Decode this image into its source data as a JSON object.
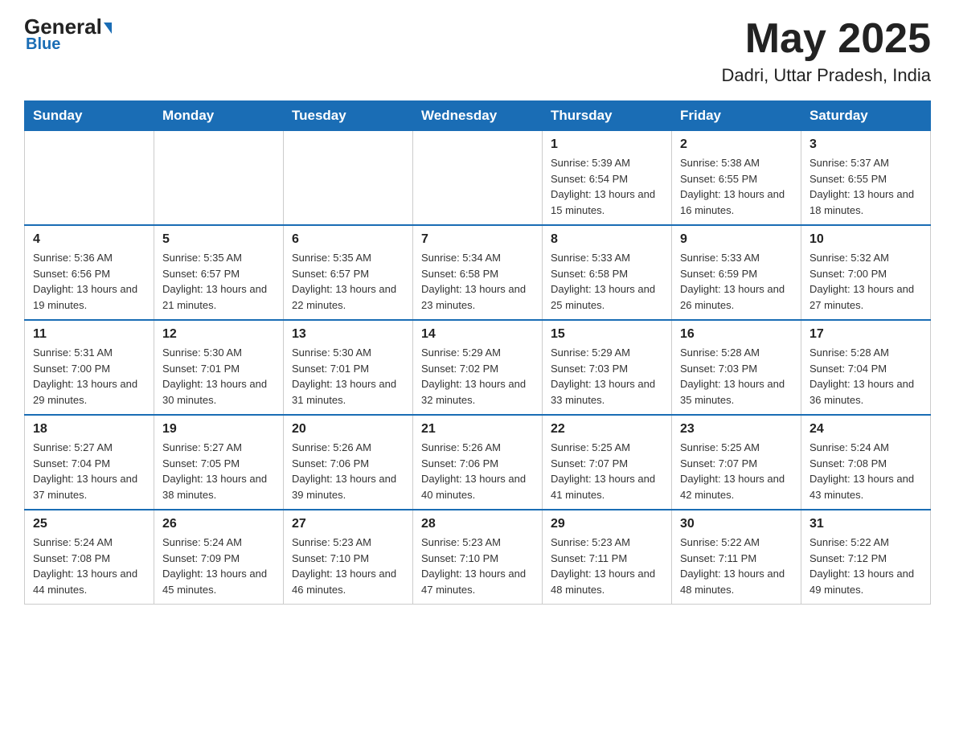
{
  "header": {
    "logo_general": "General",
    "logo_blue": "Blue",
    "month_year": "May 2025",
    "location": "Dadri, Uttar Pradesh, India"
  },
  "weekdays": [
    "Sunday",
    "Monday",
    "Tuesday",
    "Wednesday",
    "Thursday",
    "Friday",
    "Saturday"
  ],
  "weeks": [
    [
      {
        "day": "",
        "info": ""
      },
      {
        "day": "",
        "info": ""
      },
      {
        "day": "",
        "info": ""
      },
      {
        "day": "",
        "info": ""
      },
      {
        "day": "1",
        "info": "Sunrise: 5:39 AM\nSunset: 6:54 PM\nDaylight: 13 hours and 15 minutes."
      },
      {
        "day": "2",
        "info": "Sunrise: 5:38 AM\nSunset: 6:55 PM\nDaylight: 13 hours and 16 minutes."
      },
      {
        "day": "3",
        "info": "Sunrise: 5:37 AM\nSunset: 6:55 PM\nDaylight: 13 hours and 18 minutes."
      }
    ],
    [
      {
        "day": "4",
        "info": "Sunrise: 5:36 AM\nSunset: 6:56 PM\nDaylight: 13 hours and 19 minutes."
      },
      {
        "day": "5",
        "info": "Sunrise: 5:35 AM\nSunset: 6:57 PM\nDaylight: 13 hours and 21 minutes."
      },
      {
        "day": "6",
        "info": "Sunrise: 5:35 AM\nSunset: 6:57 PM\nDaylight: 13 hours and 22 minutes."
      },
      {
        "day": "7",
        "info": "Sunrise: 5:34 AM\nSunset: 6:58 PM\nDaylight: 13 hours and 23 minutes."
      },
      {
        "day": "8",
        "info": "Sunrise: 5:33 AM\nSunset: 6:58 PM\nDaylight: 13 hours and 25 minutes."
      },
      {
        "day": "9",
        "info": "Sunrise: 5:33 AM\nSunset: 6:59 PM\nDaylight: 13 hours and 26 minutes."
      },
      {
        "day": "10",
        "info": "Sunrise: 5:32 AM\nSunset: 7:00 PM\nDaylight: 13 hours and 27 minutes."
      }
    ],
    [
      {
        "day": "11",
        "info": "Sunrise: 5:31 AM\nSunset: 7:00 PM\nDaylight: 13 hours and 29 minutes."
      },
      {
        "day": "12",
        "info": "Sunrise: 5:30 AM\nSunset: 7:01 PM\nDaylight: 13 hours and 30 minutes."
      },
      {
        "day": "13",
        "info": "Sunrise: 5:30 AM\nSunset: 7:01 PM\nDaylight: 13 hours and 31 minutes."
      },
      {
        "day": "14",
        "info": "Sunrise: 5:29 AM\nSunset: 7:02 PM\nDaylight: 13 hours and 32 minutes."
      },
      {
        "day": "15",
        "info": "Sunrise: 5:29 AM\nSunset: 7:03 PM\nDaylight: 13 hours and 33 minutes."
      },
      {
        "day": "16",
        "info": "Sunrise: 5:28 AM\nSunset: 7:03 PM\nDaylight: 13 hours and 35 minutes."
      },
      {
        "day": "17",
        "info": "Sunrise: 5:28 AM\nSunset: 7:04 PM\nDaylight: 13 hours and 36 minutes."
      }
    ],
    [
      {
        "day": "18",
        "info": "Sunrise: 5:27 AM\nSunset: 7:04 PM\nDaylight: 13 hours and 37 minutes."
      },
      {
        "day": "19",
        "info": "Sunrise: 5:27 AM\nSunset: 7:05 PM\nDaylight: 13 hours and 38 minutes."
      },
      {
        "day": "20",
        "info": "Sunrise: 5:26 AM\nSunset: 7:06 PM\nDaylight: 13 hours and 39 minutes."
      },
      {
        "day": "21",
        "info": "Sunrise: 5:26 AM\nSunset: 7:06 PM\nDaylight: 13 hours and 40 minutes."
      },
      {
        "day": "22",
        "info": "Sunrise: 5:25 AM\nSunset: 7:07 PM\nDaylight: 13 hours and 41 minutes."
      },
      {
        "day": "23",
        "info": "Sunrise: 5:25 AM\nSunset: 7:07 PM\nDaylight: 13 hours and 42 minutes."
      },
      {
        "day": "24",
        "info": "Sunrise: 5:24 AM\nSunset: 7:08 PM\nDaylight: 13 hours and 43 minutes."
      }
    ],
    [
      {
        "day": "25",
        "info": "Sunrise: 5:24 AM\nSunset: 7:08 PM\nDaylight: 13 hours and 44 minutes."
      },
      {
        "day": "26",
        "info": "Sunrise: 5:24 AM\nSunset: 7:09 PM\nDaylight: 13 hours and 45 minutes."
      },
      {
        "day": "27",
        "info": "Sunrise: 5:23 AM\nSunset: 7:10 PM\nDaylight: 13 hours and 46 minutes."
      },
      {
        "day": "28",
        "info": "Sunrise: 5:23 AM\nSunset: 7:10 PM\nDaylight: 13 hours and 47 minutes."
      },
      {
        "day": "29",
        "info": "Sunrise: 5:23 AM\nSunset: 7:11 PM\nDaylight: 13 hours and 48 minutes."
      },
      {
        "day": "30",
        "info": "Sunrise: 5:22 AM\nSunset: 7:11 PM\nDaylight: 13 hours and 48 minutes."
      },
      {
        "day": "31",
        "info": "Sunrise: 5:22 AM\nSunset: 7:12 PM\nDaylight: 13 hours and 49 minutes."
      }
    ]
  ]
}
